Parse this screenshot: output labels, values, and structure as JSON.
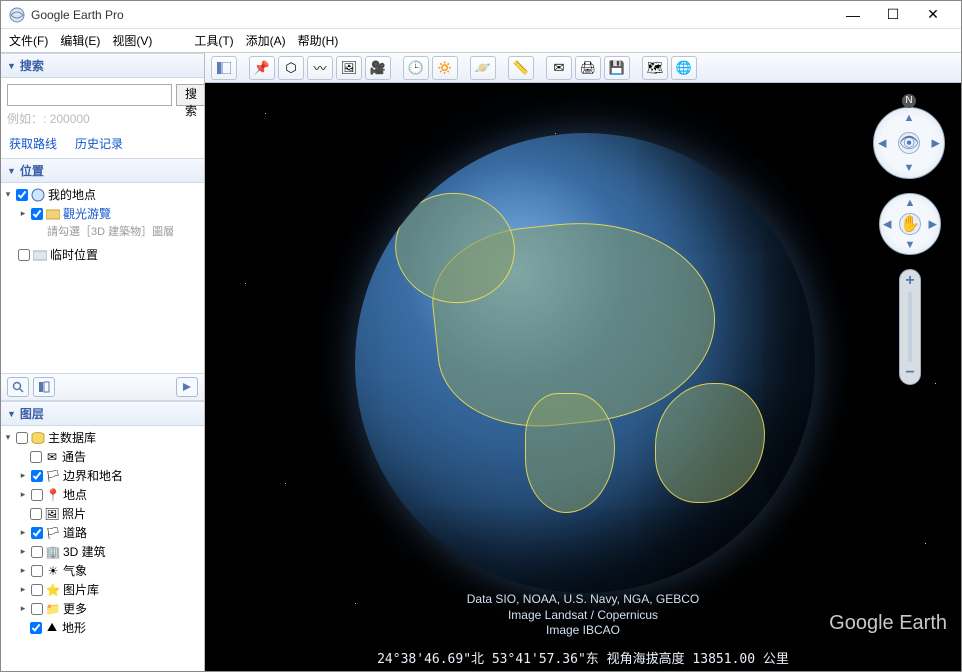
{
  "window": {
    "title": "Google Earth Pro"
  },
  "menu": {
    "file": "文件(F)",
    "edit": "编辑(E)",
    "view": "视图(V)",
    "tools": "工具(T)",
    "add": "添加(A)",
    "help": "帮助(H)"
  },
  "search": {
    "header": "搜索",
    "button": "搜索",
    "hint": "例如：: 200000",
    "link_directions": "获取路线",
    "link_history": "历史记录"
  },
  "places": {
    "header": "位置",
    "my_places": "我的地点",
    "sightseeing": "觀光游覽",
    "sightseeing_hint": "請勾選［3D 建築物］圖層",
    "temp": "临时位置"
  },
  "layers": {
    "header": "图层",
    "primary_db": "主数据库",
    "items": [
      {
        "label": "通告"
      },
      {
        "label": "边界和地名"
      },
      {
        "label": "地点"
      },
      {
        "label": "照片"
      },
      {
        "label": "道路"
      },
      {
        "label": "3D 建筑"
      },
      {
        "label": "气象"
      },
      {
        "label": "图片库"
      },
      {
        "label": "更多"
      },
      {
        "label": "地形"
      }
    ]
  },
  "attrib": {
    "l1": "Data SIO, NOAA, U.S. Navy, NGA, GEBCO",
    "l2": "Image Landsat / Copernicus",
    "l3": "Image IBCAO"
  },
  "watermark": "Google Earth",
  "status": "24°38'46.69\"北  53°41'57.36\"东 视角海拔高度 13851.00 公里",
  "compass_n": "N"
}
